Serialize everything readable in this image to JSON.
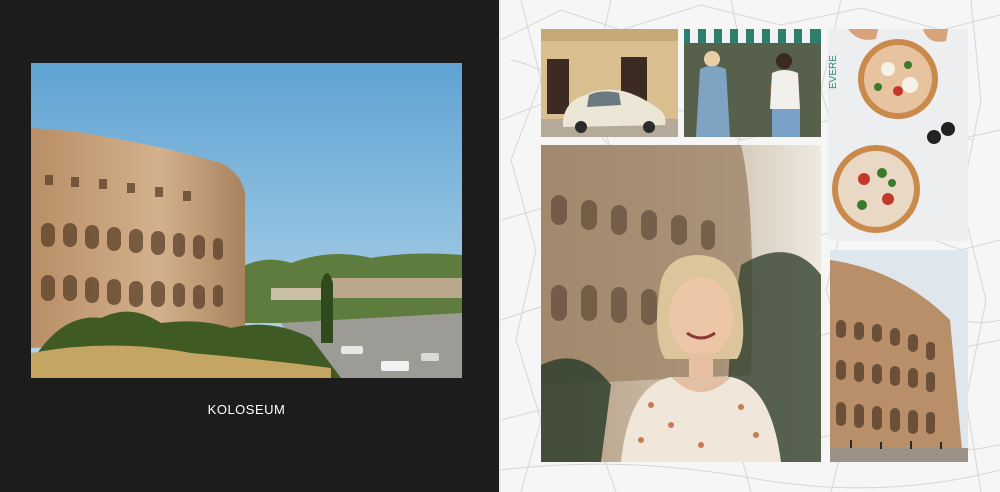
{
  "left_page": {
    "caption": "KOLOSEUM",
    "background": "#1c1c1c",
    "photo": "colosseum-exterior-photo"
  },
  "right_page": {
    "background": "map-pattern",
    "photos": [
      {
        "subject": "vintage-car-photo"
      },
      {
        "subject": "friends-street-photo"
      },
      {
        "subject": "pizza-photo"
      },
      {
        "subject": "portrait-photo"
      },
      {
        "subject": "colosseum-photo"
      }
    ]
  },
  "colors": {
    "dark_page": "#1c1c1c",
    "sky": "#79b4d8",
    "stone": "#c7a27b",
    "map_lines": "#d4d4d4"
  }
}
